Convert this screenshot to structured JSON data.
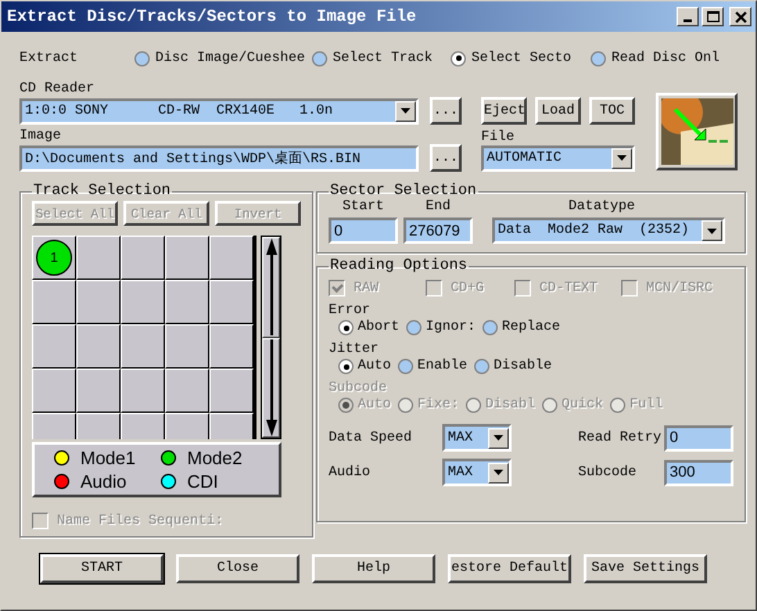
{
  "window": {
    "title": "Extract Disc/Tracks/Sectors to Image File"
  },
  "extract": {
    "label": "Extract",
    "options": [
      {
        "label": "Disc Image/Cueshee",
        "selected": false
      },
      {
        "label": "Select Track",
        "selected": false
      },
      {
        "label": "Select Secto",
        "selected": true
      },
      {
        "label": "Read Disc Onl",
        "selected": false
      }
    ]
  },
  "cd_reader": {
    "label": "CD Reader",
    "value": "1:0:0 SONY      CD-RW  CRX140E   1.0n",
    "browse": "...",
    "buttons": [
      "Eject",
      "Load",
      "TOC"
    ]
  },
  "image": {
    "label": "Image",
    "value": "D:\\Documents and Settings\\WDP\\桌面\\RS.BIN",
    "browse": "..."
  },
  "file": {
    "label": "File",
    "value": "AUTOMATIC"
  },
  "track_selection": {
    "title": "Track Selection",
    "buttons": [
      {
        "label": "Select All",
        "disabled": true
      },
      {
        "label": "Clear All",
        "disabled": true
      },
      {
        "label": "Invert",
        "disabled": true
      }
    ],
    "tracks": [
      {
        "number": "1",
        "color": "#00e000"
      }
    ],
    "legend": [
      {
        "label": "Mode1",
        "color": "#ffff00"
      },
      {
        "label": "Mode2",
        "color": "#00e000"
      },
      {
        "label": "Audio",
        "color": "#ff0000"
      },
      {
        "label": "CDI",
        "color": "#00ffff"
      }
    ],
    "name_files": {
      "label": "Name Files Sequenti:",
      "checked": false,
      "disabled": true
    }
  },
  "sector_selection": {
    "title": "Sector Selection",
    "start_label": "Start",
    "start": "0",
    "end_label": "End",
    "end": "276079",
    "datatype_label": "Datatype",
    "datatype": "Data  Mode2 Raw  (2352)"
  },
  "reading_options": {
    "title": "Reading Options",
    "checkboxes": [
      {
        "label": "RAW",
        "checked": true,
        "disabled": true
      },
      {
        "label": "CD+G",
        "checked": false,
        "disabled": true
      },
      {
        "label": "CD-TEXT",
        "checked": false,
        "disabled": true
      },
      {
        "label": "MCN/ISRC",
        "checked": false,
        "disabled": true
      }
    ],
    "groups": [
      {
        "label": "Error",
        "disabled": false,
        "options": [
          {
            "label": "Abort",
            "selected": true
          },
          {
            "label": "Ignor:",
            "selected": false
          },
          {
            "label": "Replace",
            "selected": false
          }
        ]
      },
      {
        "label": "Jitter",
        "disabled": false,
        "options": [
          {
            "label": "Auto",
            "selected": true
          },
          {
            "label": "Enable",
            "selected": false
          },
          {
            "label": "Disable",
            "selected": false
          }
        ]
      },
      {
        "label": "Subcode",
        "disabled": true,
        "options": [
          {
            "label": "Auto",
            "selected": true
          },
          {
            "label": "Fixe:",
            "selected": false
          },
          {
            "label": "Disabl",
            "selected": false
          },
          {
            "label": "Quick",
            "selected": false
          },
          {
            "label": "Full",
            "selected": false
          }
        ]
      }
    ],
    "data_speed": {
      "label": "Data Speed",
      "value": "MAX"
    },
    "read_retry": {
      "label": "Read Retry",
      "value": "0"
    },
    "audio": {
      "label": "Audio",
      "value": "MAX"
    },
    "subcode": {
      "label": "Subcode",
      "value": "300"
    }
  },
  "buttons": [
    {
      "label": "START",
      "default": true
    },
    {
      "label": "Close",
      "default": false
    },
    {
      "label": "Help",
      "default": false
    },
    {
      "label": "estore Default",
      "default": false
    },
    {
      "label": "Save Settings",
      "default": false
    }
  ]
}
